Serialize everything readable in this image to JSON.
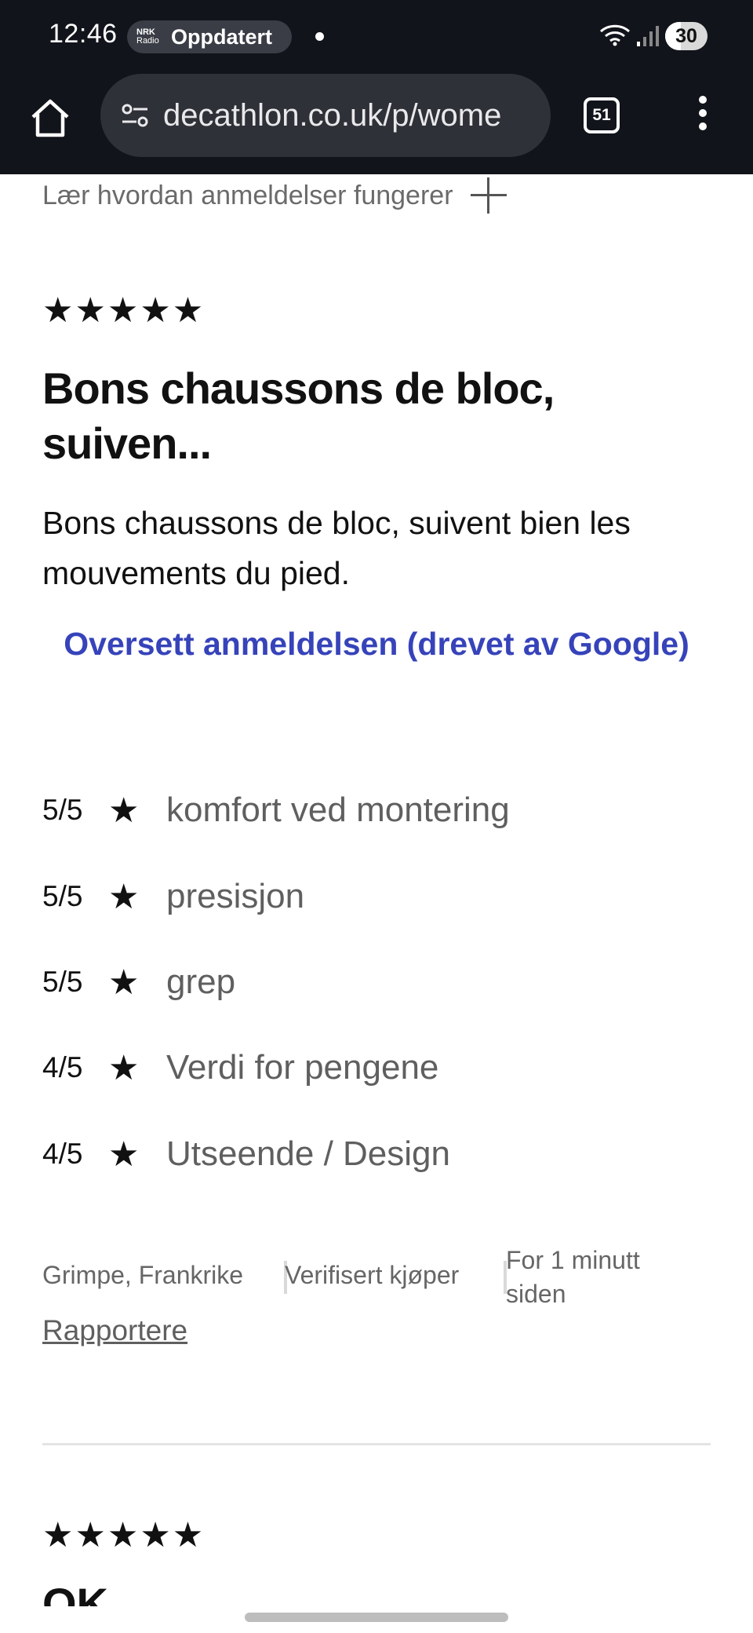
{
  "status_bar": {
    "time": "12:46",
    "nrk_logo_top": "NRK",
    "nrk_logo_bottom": "Radio",
    "notification_label": "Oppdatert",
    "battery": "30"
  },
  "browser": {
    "url": "decathlon.co.uk/p/wome",
    "tab_count": "51"
  },
  "reviews": {
    "learn_label": "Lær hvordan anmeldelser fungerer",
    "stars": "★★★★★",
    "title": "Bons chaussons de bloc, suiven...",
    "body": "Bons chaussons de bloc, suivent bien les mouvements du pied.",
    "translate_link": "Oversett anmeldelsen (drevet av Google)",
    "ratings": [
      {
        "score": "5/5",
        "star": "★",
        "label": "komfort ved montering"
      },
      {
        "score": "5/5",
        "star": "★",
        "label": "presisjon"
      },
      {
        "score": "5/5",
        "star": "★",
        "label": "grep"
      },
      {
        "score": "4/5",
        "star": "★",
        "label": "Verdi for pengene"
      },
      {
        "score": "4/5",
        "star": "★",
        "label": "Utseende / Design"
      }
    ],
    "author": "Grimpe, Frankrike",
    "verified": "Verifisert kjøper",
    "time_ago": "For 1 minutt siden",
    "report_link": "Rapportere",
    "next_stars": "★★★★★",
    "next_title": "OK"
  },
  "colors": {
    "link": "#3643ba",
    "bar": "#12141b"
  }
}
